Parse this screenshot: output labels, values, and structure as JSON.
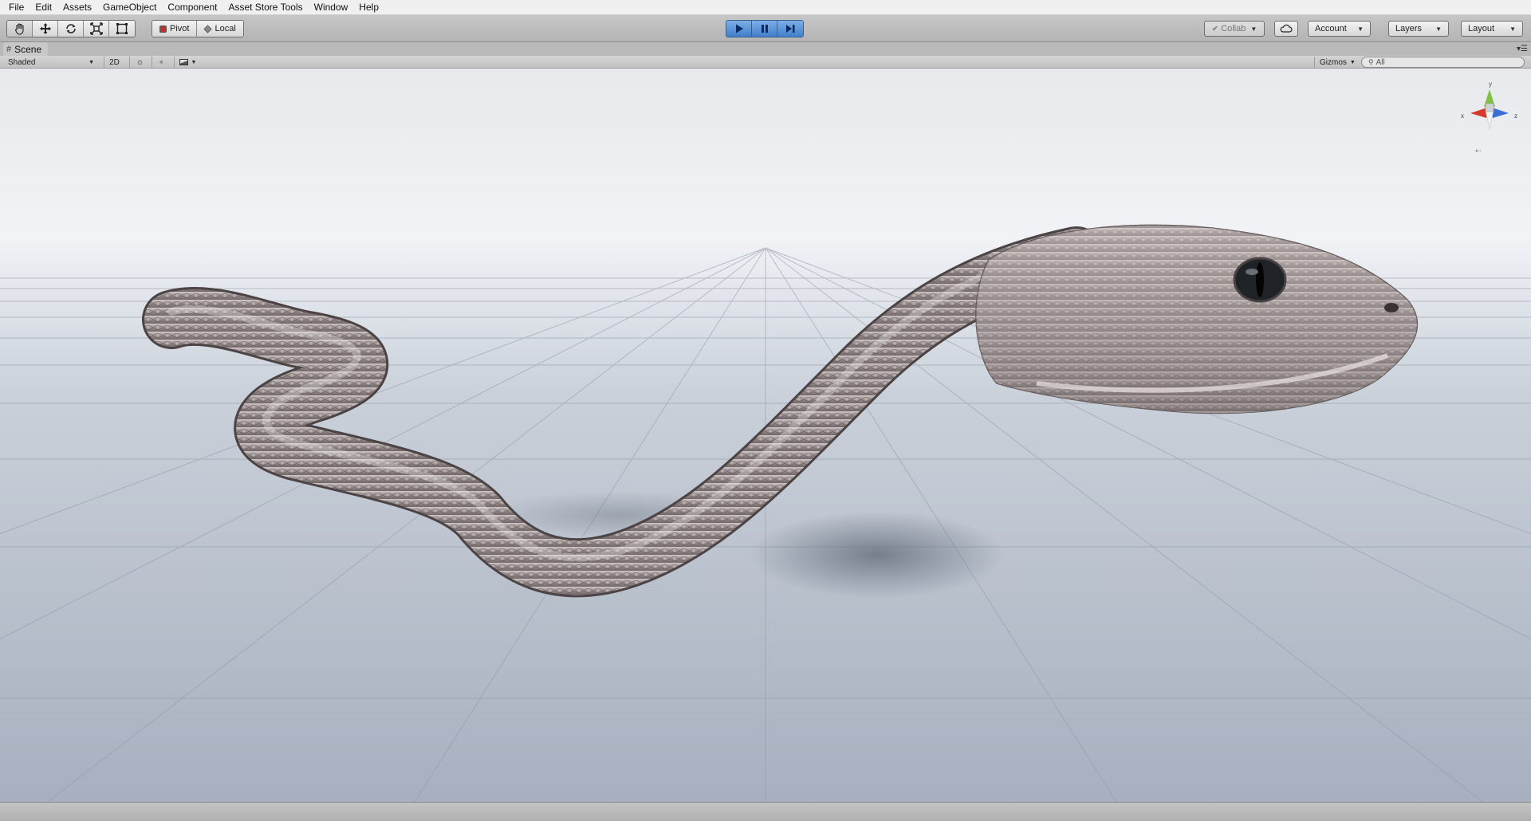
{
  "menu": [
    "File",
    "Edit",
    "Assets",
    "GameObject",
    "Component",
    "Asset Store Tools",
    "Window",
    "Help"
  ],
  "toolbar": {
    "tools": [
      {
        "name": "hand-tool",
        "icon": "hand-icon"
      },
      {
        "name": "move-tool",
        "icon": "move-icon"
      },
      {
        "name": "rotate-tool",
        "icon": "rotate-icon"
      },
      {
        "name": "scale-tool",
        "icon": "scale-icon"
      },
      {
        "name": "rect-tool",
        "icon": "rect-icon"
      }
    ],
    "pivot_label": "Pivot",
    "local_label": "Local",
    "collab_label": "Collab",
    "account_label": "Account",
    "layers_label": "Layers",
    "layout_label": "Layout",
    "accent_color": "#3f7fcb"
  },
  "scene": {
    "tab_label": "Scene",
    "shading_mode": "Shaded",
    "mode_2d_label": "2D",
    "gizmos_label": "Gizmos",
    "search_placeholder": "All",
    "gizmo_axes": {
      "x": "#d43b2a",
      "y": "#7fc241",
      "z": "#3a6fd8"
    }
  }
}
